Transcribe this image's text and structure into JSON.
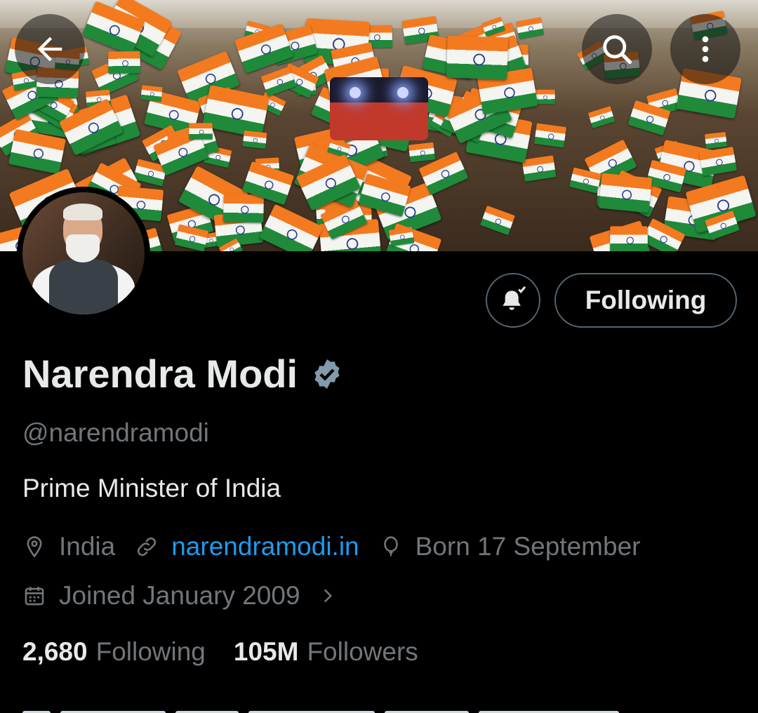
{
  "header": {
    "back_icon": "arrow-left-icon",
    "search_icon": "search-icon",
    "more_icon": "more-vertical-icon"
  },
  "profile": {
    "name": "Narendra Modi",
    "verified_icon": "verified-badge-icon",
    "handle": "@narendramodi",
    "bio": "Prime Minister of India",
    "location": "India",
    "website": "narendramodi.in",
    "birthday": "Born 17 September",
    "joined": "Joined January 2009"
  },
  "actions": {
    "notify_icon": "bell-check-icon",
    "follow_label": "Following"
  },
  "stats": {
    "following_count": "2,680",
    "following_label": "Following",
    "followers_count": "105M",
    "followers_label": "Followers"
  },
  "colors": {
    "background": "#000000",
    "text_primary": "#e7e9ea",
    "text_secondary": "#71767b",
    "link": "#1d9bf0",
    "border": "#536471",
    "verified": "#829aab"
  }
}
